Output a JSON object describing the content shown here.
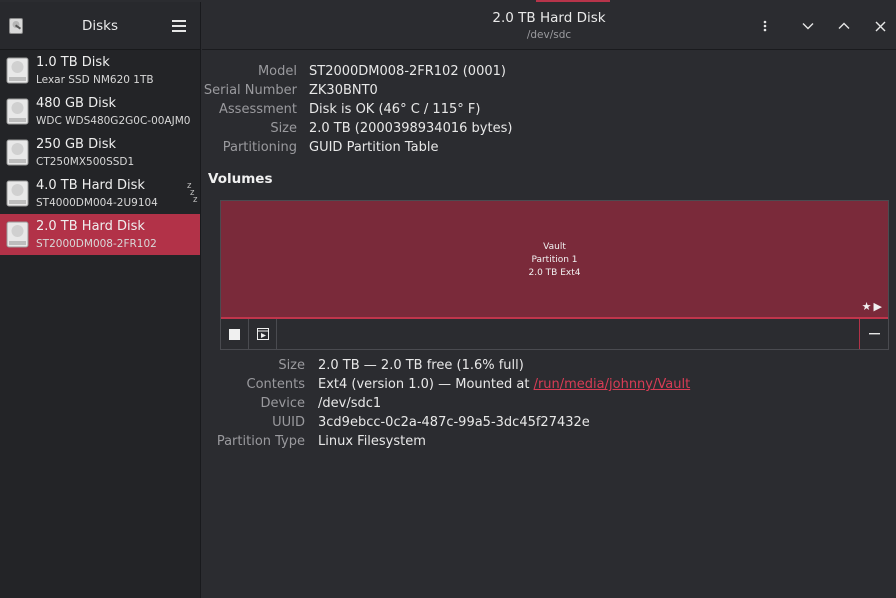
{
  "sidebar": {
    "title": "Disks",
    "disks": [
      {
        "name": "1.0 TB Disk",
        "model": "Lexar SSD NM620 1TB",
        "selected": false,
        "sleeping": false
      },
      {
        "name": "480 GB Disk",
        "model": "WDC WDS480G2G0C-00AJM0",
        "selected": false,
        "sleeping": false
      },
      {
        "name": "250 GB Disk",
        "model": "CT250MX500SSD1",
        "selected": false,
        "sleeping": false
      },
      {
        "name": "4.0 TB Hard Disk",
        "model": "ST4000DM004-2U9104",
        "selected": false,
        "sleeping": true
      },
      {
        "name": "2.0 TB Hard Disk",
        "model": "ST2000DM008-2FR102",
        "selected": true,
        "sleeping": false
      }
    ],
    "sleep_glyph": "zzz"
  },
  "header": {
    "title": "2.0 TB Hard Disk",
    "subtitle": "/dev/sdc"
  },
  "properties": [
    {
      "label": "Model",
      "value": "ST2000DM008-2FR102 (0001)"
    },
    {
      "label": "Serial Number",
      "value": "ZK30BNT0"
    },
    {
      "label": "Assessment",
      "value": "Disk is OK (46° C / 115° F)"
    },
    {
      "label": "Size",
      "value": "2.0 TB (2000398934016 bytes)"
    },
    {
      "label": "Partitioning",
      "value": "GUID Partition Table"
    }
  ],
  "volumes": {
    "title": "Volumes",
    "partition": {
      "name": "Vault",
      "number": "Partition 1",
      "size_fs": "2.0 TB Ext4"
    },
    "flag_glyphs": [
      "★",
      "▶"
    ]
  },
  "partition_details": {
    "size": {
      "label": "Size",
      "value": "2.0 TB — 2.0 TB free (1.6% full)"
    },
    "contents": {
      "label": "Contents",
      "prefix": "Ext4 (version 1.0) — Mounted at ",
      "link": "/run/media/johnny/Vault"
    },
    "device": {
      "label": "Device",
      "value": "/dev/sdc1"
    },
    "uuid": {
      "label": "UUID",
      "value": "3cd9ebcc-0c2a-487c-99a5-3dc45f27432e"
    },
    "type": {
      "label": "Partition Type",
      "value": "Linux Filesystem"
    }
  },
  "colors": {
    "accent": "#b23248",
    "partition_fill": "#7a2a3a",
    "link": "#d83c55"
  }
}
